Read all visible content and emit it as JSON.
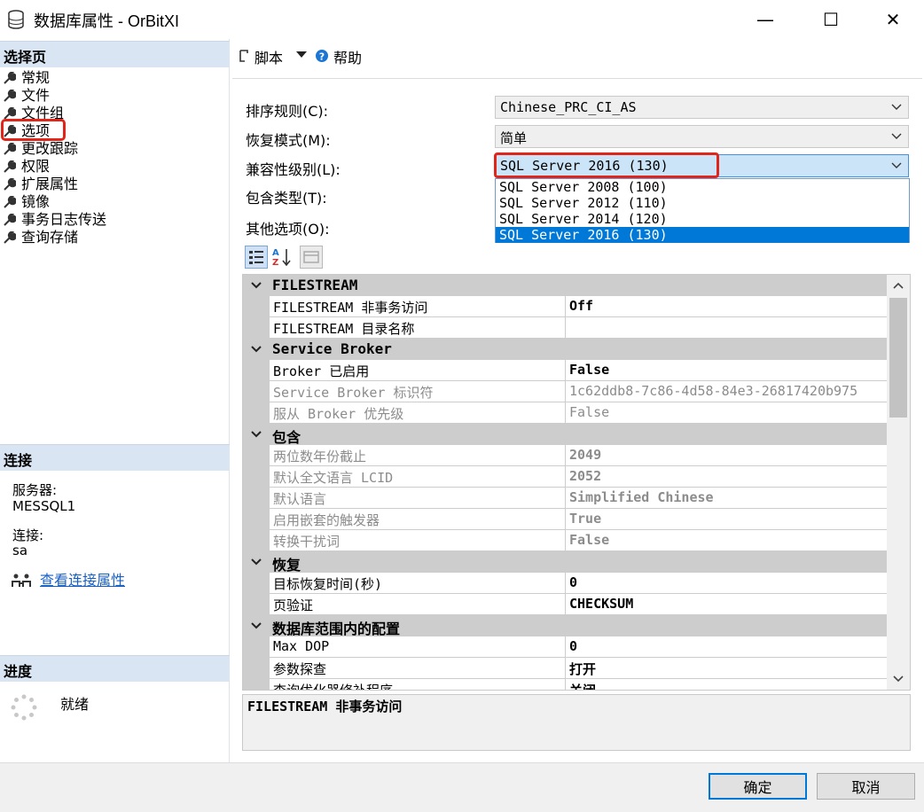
{
  "window": {
    "title": "数据库属性 - OrBitXI",
    "minimize_glyph": "—",
    "maximize_glyph": "☐",
    "close_glyph": "✕"
  },
  "left": {
    "select_page_header": "选择页",
    "nav": [
      {
        "label": "常规"
      },
      {
        "label": "文件"
      },
      {
        "label": "文件组"
      },
      {
        "label": "选项"
      },
      {
        "label": "更改跟踪"
      },
      {
        "label": "权限"
      },
      {
        "label": "扩展属性"
      },
      {
        "label": "镜像"
      },
      {
        "label": "事务日志传送"
      },
      {
        "label": "查询存储"
      }
    ],
    "connection_header": "连接",
    "server_label": "服务器:",
    "server_value": "MESSQL1",
    "conn_label": "连接:",
    "conn_value": "sa",
    "view_conn_props": "查看连接属性",
    "progress_header": "进度",
    "progress_status": "就绪"
  },
  "toolbar": {
    "script_label": "脚本",
    "help_label": "帮助"
  },
  "props": {
    "collation_label": "排序规则(C):",
    "collation_value": "Chinese_PRC_CI_AS",
    "recovery_label": "恢复模式(M):",
    "recovery_value": "简单",
    "compat_label": "兼容性级别(L):",
    "compat_value": "SQL Server 2016 (130)",
    "containment_label": "包含类型(T):",
    "other_label": "其他选项(O):",
    "compat_options": [
      "SQL Server 2008 (100)",
      "SQL Server 2012 (110)",
      "SQL Server 2014 (120)",
      "SQL Server 2016 (130)"
    ]
  },
  "grid": {
    "cat_filestream": "FILESTREAM",
    "fs_nontx_name": "FILESTREAM 非事务访问",
    "fs_nontx_value": "Off",
    "fs_dir_name": "FILESTREAM 目录名称",
    "fs_dir_value": "",
    "cat_broker": "Service Broker",
    "broker_enabled_name": "Broker 已启用",
    "broker_enabled_value": "False",
    "broker_id_name": "Service Broker 标识符",
    "broker_id_value": "1c62ddb8-7c86-4d58-84e3-26817420b975",
    "broker_priority_name": "服从 Broker 优先级",
    "broker_priority_value": "False",
    "cat_containment": "包含",
    "two_digit_name": "两位数年份截止",
    "two_digit_value": "2049",
    "fulltext_lcid_name": "默认全文语言 LCID",
    "fulltext_lcid_value": "2052",
    "default_lang_name": "默认语言",
    "default_lang_value": "Simplified Chinese",
    "nested_trig_name": "启用嵌套的触发器",
    "nested_trig_value": "True",
    "noise_name": "转换干扰词",
    "noise_value": "False",
    "cat_recovery": "恢复",
    "target_recovery_name": "目标恢复时间(秒)",
    "target_recovery_value": "0",
    "page_verify_name": "页验证",
    "page_verify_value": "CHECKSUM",
    "cat_scoped": "数据库范围内的配置",
    "maxdop_name": "Max DOP",
    "maxdop_value": "0",
    "param_sniff_name": "参数探查",
    "param_sniff_value": "打开",
    "qo_fix_name": "查询优化器修补程序",
    "qo_fix_value": "关闭"
  },
  "description": "FILESTREAM 非事务访问",
  "buttons": {
    "ok": "确定",
    "cancel": "取消"
  },
  "colors": {
    "accent": "#0078d7",
    "highlight_red": "#e0251b",
    "header_blue": "#d9e5f2"
  }
}
